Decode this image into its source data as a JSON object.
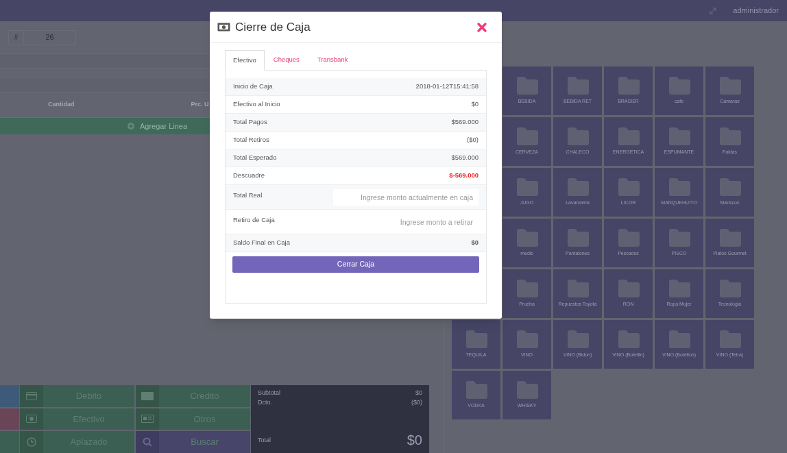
{
  "header": {
    "user": "administrador"
  },
  "ticket": {
    "prefix": "#",
    "number": "26"
  },
  "table": {
    "columns": [
      "Cantidad",
      "Prc. U"
    ]
  },
  "add_line": "Agregar Linea",
  "payment_buttons": [
    {
      "label": "Debito",
      "kind": "card",
      "color": "#3b5f52"
    },
    {
      "label": "Credito",
      "kind": "visa",
      "color": "#3b5f52"
    },
    {
      "label": "Efectivo",
      "kind": "cash",
      "color": "#3b5f52"
    },
    {
      "label": "Otros",
      "kind": "other",
      "color": "#3b5f52"
    },
    {
      "label": "Aplazado",
      "kind": "clock",
      "color": "#3b5f52"
    },
    {
      "label": "Buscar",
      "kind": "search",
      "color": "#47456a"
    }
  ],
  "side_buttons": [
    {
      "color": "#3d5b78"
    },
    {
      "color": "#6a4557"
    },
    {
      "color": "#3b5f52"
    }
  ],
  "summary": {
    "rows": [
      {
        "label": "Subtotal",
        "value": "$0"
      },
      {
        "label": "Dcto.",
        "value": "($0)"
      }
    ],
    "total_label": "Total",
    "total": "$0"
  },
  "category_rows": [
    [
      "BEBIDA",
      "BEBIDA RET",
      "BRASIER",
      "cafe",
      "Camaras"
    ],
    [
      "CERVEZA",
      "CHALECO",
      "ENERGETICA",
      "ESPUMANTE",
      "Faldas"
    ],
    [
      "JUGO",
      "Lavanderia",
      "LICOR",
      "MANQUEHUITO",
      "Mariscos"
    ],
    [
      "medic",
      "Pantalones",
      "Pescados",
      "PISCO",
      "Platos Gourmet"
    ],
    [
      "Prueba",
      "Repuestos Toyota",
      "RON",
      "Ropa Mujer",
      "Tecnologia"
    ],
    [
      "TEQUILA",
      "VINO",
      "VINO (Bidon)",
      "VINO (Botellin)",
      "VINO (Botellon)",
      "VINO (Tetra)"
    ],
    [
      "VODKA",
      "WHISKY"
    ]
  ],
  "modal": {
    "title": "Cierre de Caja",
    "tabs": [
      {
        "label": "Efectivo",
        "selected": true
      },
      {
        "label": "Cheques",
        "selected": false
      },
      {
        "label": "Transbank",
        "selected": false
      }
    ],
    "rows": [
      {
        "kind": "value",
        "label": "Inicio de Caja",
        "value": "2018-01-12T15:41:58"
      },
      {
        "kind": "value",
        "label": "Efectivo al Inicio",
        "value": "$0"
      },
      {
        "kind": "value",
        "label": "Total Pagos",
        "value": "$569.000"
      },
      {
        "kind": "value",
        "label": "Total Retiros",
        "value": "($0)"
      },
      {
        "kind": "value",
        "label": "Total Esperado",
        "value": "$569.000"
      },
      {
        "kind": "alert",
        "label": "Descuadre",
        "value": "$-569.000"
      },
      {
        "kind": "input",
        "label": "Total Real",
        "placeholder": "Ingrese monto actualmente en caja"
      },
      {
        "kind": "input",
        "label": "Retiro de Caja",
        "placeholder": "Ingrese monto a retirar"
      },
      {
        "kind": "bold",
        "label": "Saldo Final en Caja",
        "value": "$0"
      }
    ],
    "button": "Cerrar Caja"
  }
}
